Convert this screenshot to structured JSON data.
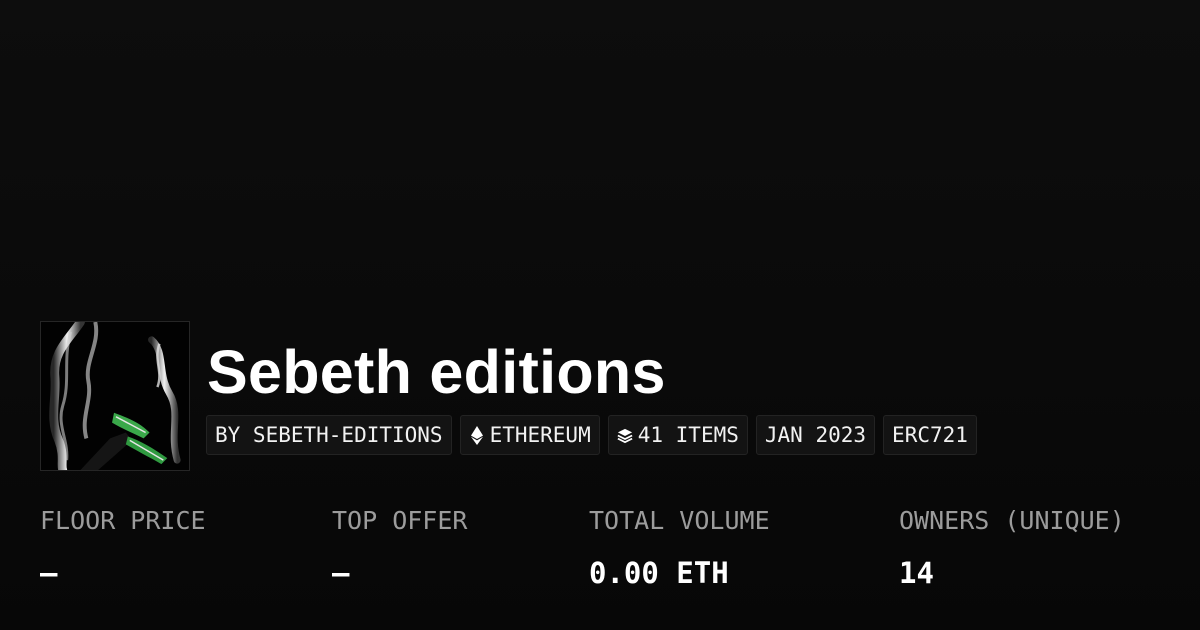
{
  "collection": {
    "name": "Sebeth editions",
    "thumbnail_icon": "collection-artwork-image"
  },
  "badges": {
    "creator": "BY SEBETH-EDITIONS",
    "chain": {
      "label": "ETHEREUM",
      "icon": "ethereum-icon"
    },
    "items": {
      "label": "41 ITEMS",
      "icon": "layers-icon"
    },
    "date": "JAN 2023",
    "standard": "ERC721"
  },
  "stats": {
    "floor_price": {
      "label": "FLOOR PRICE",
      "value": "—"
    },
    "top_offer": {
      "label": "TOP OFFER",
      "value": "—"
    },
    "total_volume": {
      "label": "TOTAL VOLUME",
      "value": "0.00 ETH"
    },
    "owners": {
      "label": "OWNERS (UNIQUE)",
      "value": "14"
    }
  },
  "colors": {
    "background": "#0a0a0a",
    "badge_background": "#131313",
    "label_gray": "#9c9c9c",
    "accent_green": "#3aa84a"
  }
}
